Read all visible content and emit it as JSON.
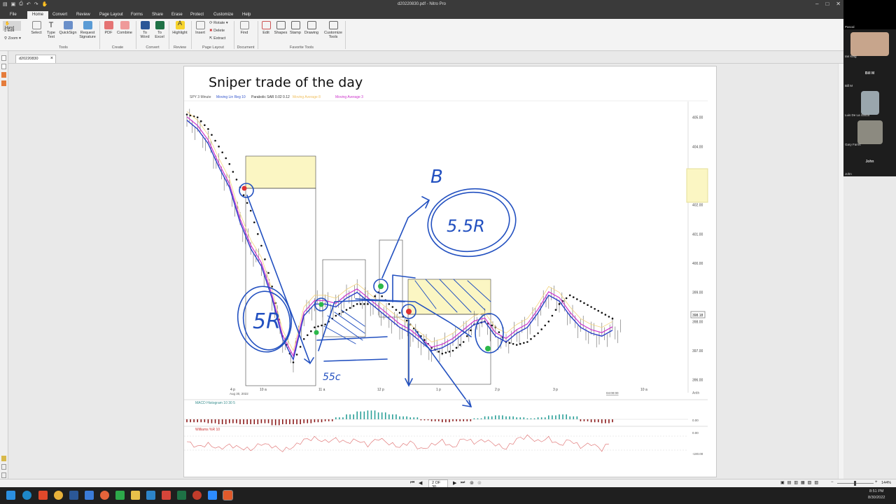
{
  "app": {
    "window_title": "d20220830.pdf - Nitro Pro",
    "window_controls": [
      "–",
      "□",
      "✕"
    ]
  },
  "menu": {
    "file": "File",
    "tabs": [
      "Home",
      "Convert",
      "Review",
      "Page Layout",
      "Forms",
      "Share",
      "Erase",
      "Protect",
      "Customize",
      "Help"
    ],
    "active": "Home"
  },
  "ribbon": {
    "mode_items": [
      "Hand",
      "Edit",
      "Zoom"
    ],
    "tools": {
      "select": "Select",
      "type_text": "Type Text",
      "quicksign": "QuickSign",
      "request_signature": "Request Signature",
      "pdf": "PDF",
      "combine": "Combine",
      "to_word": "To Word",
      "to_excel": "To Excel",
      "highlight": "Highlight",
      "insert": "Insert",
      "rotate": "Rotate",
      "delete": "Delete",
      "extract": "Extract",
      "find": "Find",
      "edit": "Edit",
      "shapes": "Shapes",
      "stamp": "Stamp",
      "drawing": "Drawing",
      "customize_tools": "Customize Tools"
    },
    "groups": {
      "tools": "Tools",
      "create": "Create",
      "convert": "Convert",
      "review": "Review",
      "page_layout": "Page Layout",
      "document": "Document",
      "favorite_tools": "Favorite Tools"
    }
  },
  "document_tab": {
    "label": "d20220830",
    "close": "×"
  },
  "slide": {
    "title": "Sniper trade of the day",
    "chart_header": {
      "symbol": "SPY 3 Minute",
      "ind1": "Moving Lin Reg 10",
      "ind2": "Parabolic SAR 0.02 0.12",
      "ind3": "Moving Average 8",
      "ind4": "Moving Average 3"
    },
    "price_labels": [
      "405.00",
      "404.00",
      "403.00",
      "402.00",
      "401.00",
      "400.00",
      "399.00",
      "398.00",
      "397.00",
      "396.00"
    ],
    "last_price": "398.18",
    "time_labels": [
      "4 p",
      "10 a",
      "11 a",
      "12 p",
      "1 p",
      "2 p",
      "3 p",
      "10 a"
    ],
    "date_label": "Aug 30, 2022",
    "time_marker": "04:00:00",
    "arith_label": "Arith",
    "macd_label": "MACD Histogram 10 30 5",
    "macd_scale": [
      "0.00"
    ],
    "williams_label": "Williams %R 10",
    "williams_scale": [
      "0.00",
      "-100.00"
    ],
    "annotations": [
      "5R",
      "5.5R",
      "55c",
      "B"
    ]
  },
  "chart_data": {
    "type": "line",
    "title": "SPY 3 Minute",
    "ylim": [
      395.8,
      405.4
    ],
    "series": [
      {
        "name": "Moving Lin Reg 10",
        "x": [
          0,
          1,
          2,
          3,
          4,
          5,
          6,
          7,
          8,
          9,
          10,
          11,
          12,
          13,
          14,
          15,
          16,
          17,
          18,
          19,
          20,
          21,
          22,
          23,
          24,
          25,
          26,
          27,
          28,
          29,
          30,
          31,
          32,
          33,
          34,
          35,
          36,
          37,
          38,
          39,
          40
        ],
        "values": [
          404.9,
          404.6,
          404.1,
          403.3,
          402.6,
          401.4,
          400.5,
          399.9,
          398.8,
          397.4,
          396.7,
          398.2,
          398.6,
          398.6,
          398.5,
          398.8,
          399.0,
          398.7,
          398.4,
          398.1,
          397.8,
          397.6,
          397.3,
          397.0,
          397.1,
          397.3,
          397.6,
          397.9,
          398.0,
          397.5,
          397.3,
          397.6,
          397.8,
          398.3,
          398.9,
          398.7,
          398.2,
          397.8,
          397.6,
          397.5,
          397.7
        ]
      }
    ],
    "parabolic_sar": [
      405.1,
      405.0,
      404.6,
      404.0,
      403.4,
      402.6,
      401.8,
      400.6,
      399.2,
      397.5,
      396.6,
      397.4,
      397.8,
      397.9,
      398.2,
      398.4,
      398.6,
      398.6,
      399.0,
      398.6,
      398.3,
      397.9,
      397.5,
      397.1,
      396.9,
      397.0,
      397.3,
      397.9,
      398.0,
      397.8,
      397.3,
      397.2,
      397.3,
      397.6,
      398.0,
      398.6,
      398.9,
      398.7,
      398.5,
      398.3,
      398.1
    ],
    "macd_histogram": [
      -0.03,
      -0.03,
      -0.04,
      -0.05,
      -0.04,
      -0.05,
      -0.05,
      -0.04,
      -0.06,
      -0.05,
      -0.05,
      -0.04,
      -0.03,
      -0.02,
      0.02,
      0.05,
      0.08,
      0.09,
      0.07,
      0.05,
      0.03,
      0.02,
      -0.01,
      -0.02,
      -0.03,
      -0.02,
      -0.02,
      0.01,
      0.03,
      0.04,
      0.03,
      0.02,
      0.01,
      0.02,
      0.04,
      0.05,
      0.03,
      -0.02,
      -0.03,
      -0.04,
      -0.03
    ],
    "williams_r": [
      -40,
      -70,
      -55,
      -80,
      -60,
      -75,
      -85,
      -50,
      -65,
      -90,
      -70,
      -30,
      -20,
      -40,
      -25,
      -45,
      -30,
      -60,
      -20,
      -50,
      -70,
      -40,
      -85,
      -60,
      -35,
      -75,
      -20,
      -45,
      -30,
      -55,
      -80,
      -25,
      -10,
      -40,
      -20,
      -60,
      -30,
      -70,
      -50,
      -85,
      -30
    ]
  },
  "statusbar": {
    "page_indicator": "2 OF 30",
    "zoom": "144%"
  },
  "participants": [
    {
      "name": "Pascal",
      "label": "Pascal"
    },
    {
      "name": "Ian King",
      "label": "Ian King"
    },
    {
      "name": "Bill M",
      "label": "Bill M"
    },
    {
      "name": "Luis De La Garza",
      "label": "Luis De La Garza"
    },
    {
      "name": "Gary Farris",
      "label": "Gary Farris"
    },
    {
      "name": "John",
      "label": "John"
    }
  ],
  "taskbar": {
    "time": "8:51 PM",
    "date": "8/30/2022"
  }
}
